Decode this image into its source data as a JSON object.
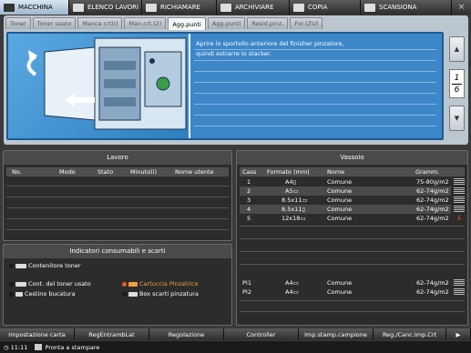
{
  "top_tabs": [
    {
      "label": "MACCHINA",
      "icon": "machine-icon",
      "active": true
    },
    {
      "label": "ELENCO LAVORI",
      "icon": "job-list-icon",
      "active": false
    },
    {
      "label": "RICHIAMARE",
      "icon": "recall-icon",
      "active": false
    },
    {
      "label": "ARCHIVIARE",
      "icon": "store-icon",
      "active": false
    },
    {
      "label": "COPIA",
      "icon": "copy-icon",
      "active": false
    },
    {
      "label": "SCANSIONA",
      "icon": "scan-icon",
      "active": false
    }
  ],
  "close_icon": "×",
  "sub_tabs": [
    "Toner",
    "Toner usato",
    "Manca crt(I)",
    "Man.crt.(2)",
    "Agg.punti",
    "Agg.punti",
    "Resid.pinz.",
    "For.(ZU)"
  ],
  "active_sub_tab": 4,
  "message": {
    "line1": "Aprire lo sportello anteriore del finisher pinzatore,",
    "line2": "quindi estrarre lo stacker."
  },
  "page_indicator": {
    "current": "1",
    "total": "6"
  },
  "scroll": {
    "up": "▲",
    "down": "▼"
  },
  "lavoro": {
    "title": "Lavoro",
    "columns": [
      "No.",
      "Modo",
      "Stato",
      "Minuto(i)",
      "Nome utente"
    ]
  },
  "vassoio": {
    "title": "Vassoio",
    "columns": [
      "Cass",
      "Formato (mm)",
      "Nome",
      "Gramm."
    ],
    "rows": [
      {
        "cass": "1",
        "formato": "A4▯",
        "nome": "Comune",
        "gramm": "75-80g/m2",
        "indicator": "bars"
      },
      {
        "cass": "2",
        "formato": "A5▭",
        "nome": "Comune",
        "gramm": "62-74g/m2",
        "indicator": "bars"
      },
      {
        "cass": "3",
        "formato": "8.5x11▭",
        "nome": "Comune",
        "gramm": "62-74g/m2",
        "indicator": "bars"
      },
      {
        "cass": "4",
        "formato": "8.5x11▯",
        "nome": "Comune",
        "gramm": "62-74g/m2",
        "indicator": "bars"
      },
      {
        "cass": "5",
        "formato": "12x18▭",
        "nome": "Comune",
        "gramm": "62-74g/m2",
        "indicator": "warning"
      }
    ],
    "bottom_rows": [
      {
        "cass": "PI1",
        "formato": "A4▭",
        "nome": "Comune",
        "gramm": "62-74g/m2",
        "indicator": "bars"
      },
      {
        "cass": "PI2",
        "formato": "A4▭",
        "nome": "Comune",
        "gramm": "62-74g/m2",
        "indicator": "bars"
      }
    ]
  },
  "consumabili": {
    "title": "Indicatori consumabili e scarti",
    "contenitore_toner": "Contenitore toner",
    "cont_toner_usato": "Cont. del toner usato",
    "cestino_bucatura": "Cestino bucatura",
    "cartuccia_pinzatrice": "Cartuccia Pinzatrice",
    "box_scarti": "Box scarti pinzatura",
    "warning_color": "#f0a040"
  },
  "bottom_buttons": [
    "Impostazione carta",
    "RegEntrambLat",
    "Regolazione",
    "Controller",
    "Imp.stamp.campione",
    "Reg./Canc.Imp.Crt"
  ],
  "bottom_arrow": "▶",
  "status": {
    "time": "11:11",
    "text": "Pronta a stampare"
  }
}
